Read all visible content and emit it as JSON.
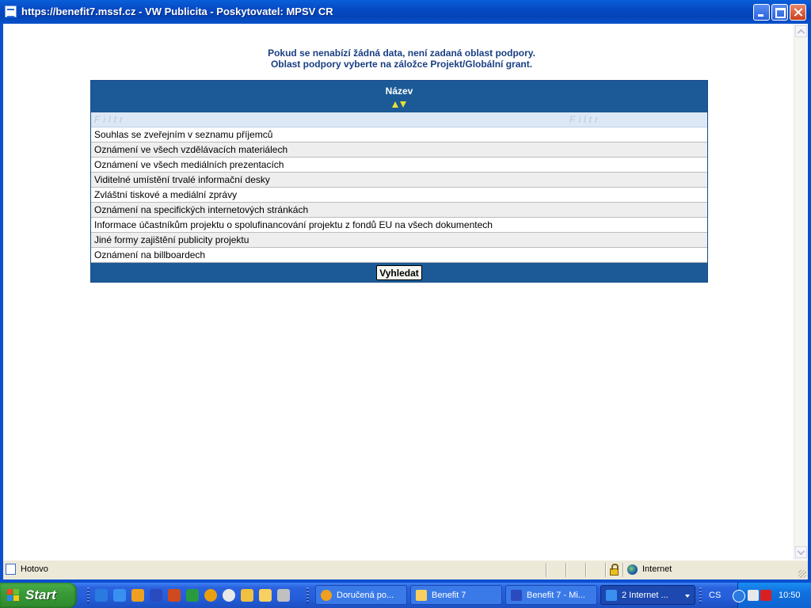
{
  "window": {
    "title": "https://benefit7.mssf.cz - VW Publicita - Poskytovatel: MPSV CR"
  },
  "message": {
    "line1": "Pokud se nenabízí žádná data, není zadaná oblast podpory.",
    "line2": "Oblast podpory vyberte na záložce Projekt/Globální grant."
  },
  "grid": {
    "header": "Název",
    "filter_left": "Filtr",
    "filter_right": "Filtr",
    "rows": [
      "Souhlas se zveřejním v seznamu příjemců",
      "Oznámení ve všech vzdělávacích materiálech",
      "Oznámení ve všech mediálních prezentacích",
      "Viditelné umístění trvalé informační desky",
      "Zvláštní tiskové a mediální zprávy",
      "Oznámení na specifických internetových stránkách",
      "Informace účastníkům projektu o spolufinancování projektu z fondů EU na všech dokumentech",
      "Jiné formy zajištění publicity projektu",
      "Oznámení na billboardech"
    ],
    "search_button": "Vyhledat"
  },
  "statusbar": {
    "status": "Hotovo",
    "zone": "Internet"
  },
  "taskbar": {
    "start": "Start",
    "tasks": [
      {
        "label": "Doručená po...",
        "icon": "clock-icon"
      },
      {
        "label": "Benefit 7",
        "icon": "folder-icon"
      },
      {
        "label": "Benefit 7 - Mi...",
        "icon": "word-icon"
      },
      {
        "label": "2 Internet ...",
        "icon": "ie-icon"
      }
    ],
    "language": "CS",
    "clock": "10:50"
  },
  "colors": {
    "grid_header": "#1b5a96",
    "message_text": "#1a3f82",
    "sort_arrows": "#e8e030"
  }
}
